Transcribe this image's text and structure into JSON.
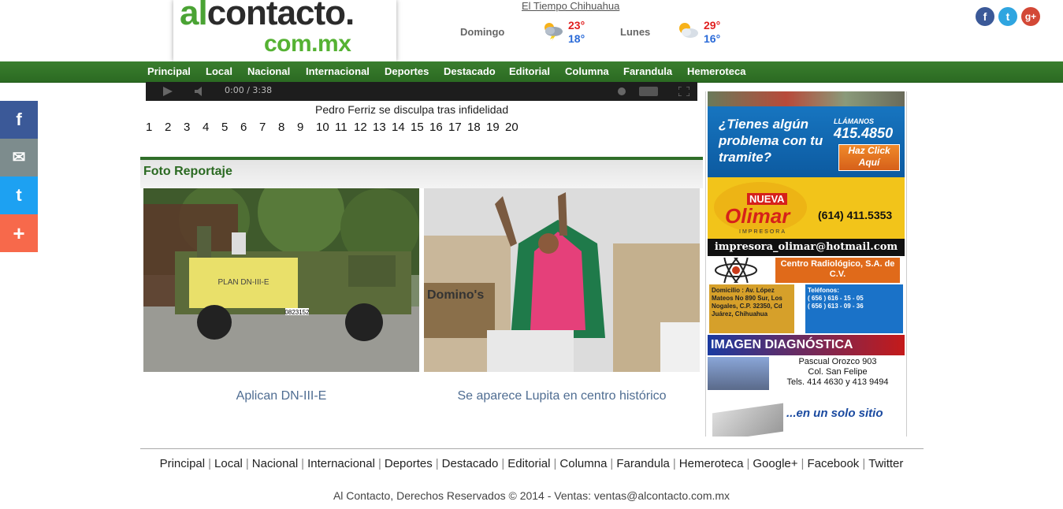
{
  "header": {
    "logo": {
      "line1_a": "al",
      "line1_b": "contacto.",
      "line2": "com.mx"
    },
    "weather": {
      "title": "El Tiempo Chihuahua",
      "days": [
        {
          "name": "Domingo",
          "high": "23°",
          "low": "18°",
          "icon": "storm-cloud-icon"
        },
        {
          "name": "Lunes",
          "high": "29°",
          "low": "16°",
          "icon": "partly-cloudy-icon"
        }
      ]
    },
    "social": {
      "facebook": "f",
      "twitter": "t",
      "googleplus": "g+"
    }
  },
  "nav": {
    "items": [
      "Principal",
      "Local",
      "Nacional",
      "Internacional",
      "Deportes",
      "Destacado",
      "Editorial",
      "Columna",
      "Farandula",
      "Hemeroteca"
    ]
  },
  "share_bar": {
    "items": [
      {
        "icon": "facebook-icon",
        "glyph": "f",
        "color": "#3b5998"
      },
      {
        "icon": "email-icon",
        "glyph": "✉",
        "color": "#7d8c8d"
      },
      {
        "icon": "twitter-icon",
        "glyph": "t",
        "color": "#1da1f2"
      },
      {
        "icon": "plus-icon",
        "glyph": "+",
        "color": "#f7694b"
      }
    ]
  },
  "video": {
    "time": "0:00 / 3:38",
    "title": "Pedro Ferriz se disculpa tras infidelidad",
    "pages": [
      "1",
      "2",
      "3",
      "4",
      "5",
      "6",
      "7",
      "8",
      "9",
      "10",
      "11",
      "12",
      "13",
      "14",
      "15",
      "16",
      "17",
      "18",
      "19",
      "20"
    ]
  },
  "foto_reportaje": {
    "title": "Foto Reportaje",
    "items": [
      {
        "caption": "Aplican DN-III-E",
        "banner": "PLAN DN-III-E",
        "plate": "0823152"
      },
      {
        "caption": "Se aparece Lupita en centro histórico",
        "sign": "Domino's"
      }
    ]
  },
  "sidebar": {
    "ad1": {
      "question": "¿Tienes algún problema con tu tramite?",
      "call": "LLÁMANOS",
      "phone": "415.4850",
      "cta": "Haz Click Aquí"
    },
    "ad2": {
      "nueva": "NUEVA",
      "brand": "Olimar",
      "sub": "IMPRESORA",
      "phone": "(614) 411.5353",
      "email": "impresora_olimar@hotmail.com"
    },
    "ad3": {
      "name": "Centro Radiológico, S.A. de C.V.",
      "address": "Domicilio : Av. López Mateos No 890 Sur, Los Nogales, C.P. 32350, Cd Juárez, Chihuahua",
      "phones_label": "Teléfonos:",
      "phone1": "( 656 ) 616 - 15 - 05",
      "phone2": "( 656 ) 613 - 09 - 36"
    },
    "ad4": {
      "title": "IMAGEN DIAGNÓSTICA",
      "address1": "Pascual Orozco 903",
      "address2": "Col. San Felipe",
      "phones": "Tels. 414 4630 y 413 9494"
    },
    "ad5": {
      "text": "...en un solo sitio"
    }
  },
  "footer": {
    "links": [
      "Principal",
      "Local",
      "Nacional",
      "Internacional",
      "Deportes",
      "Destacado",
      "Editorial",
      "Columna",
      "Farandula",
      "Hemeroteca",
      "Google+",
      "Facebook",
      "Twitter"
    ],
    "copyright": "Al Contacto, Derechos Reservados © 2014 - Ventas: ventas@alcontacto.com.mx"
  }
}
